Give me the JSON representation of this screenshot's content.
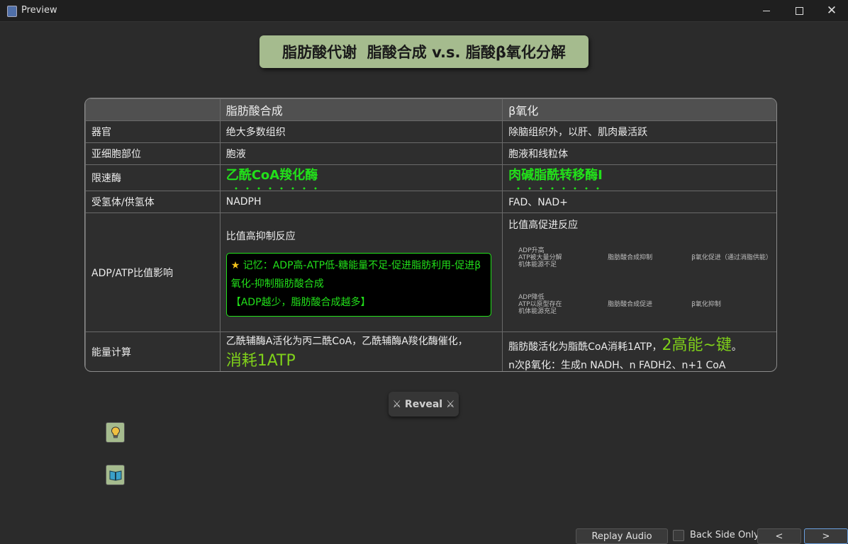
{
  "window": {
    "title": "Preview"
  },
  "card": {
    "title": "脂肪酸代谢  脂酸合成 v.s. 脂酸β氧化分解"
  },
  "table": {
    "headers": [
      "",
      "脂肪酸合成",
      "β氧化"
    ],
    "rows": {
      "organ": {
        "label": "器官",
        "synth": "绝大多数组织",
        "beta": "除脑组织外，以肝、肌肉最活跃"
      },
      "subcell": {
        "label": "亚细胞部位",
        "synth": "胞液",
        "beta": "胞液和线粒体"
      },
      "enzyme": {
        "label": "限速酶",
        "synth": "乙酰CoA羧化酶",
        "beta": "肉碱脂酰转移酶Ⅰ"
      },
      "acceptor": {
        "label": "受氢体/供氢体",
        "synth": "NADPH",
        "beta": "FAD、NAD+"
      },
      "adp": {
        "label": "ADP/ATP比值影响",
        "synth": "比值高抑制反应",
        "memory_line1": "记忆：ADP高-ATP低-糖能量不足-促进脂肪利用-促进β氧化-抑制脂肪酸合成",
        "memory_line2": "【ADP越少，脂肪酸合成越多】",
        "beta": "比值高促进反应",
        "mini_table": {
          "r1c1_l1": "ADP升高",
          "r1c1_l2": "ATP被大量分解",
          "r1c1_l3": "机体能源不足",
          "r1c2": "脂肪酸合成抑制",
          "r1c3": "β氧化促进（通过消脂供能）",
          "r2c1_l1": "ADP降低",
          "r2c1_l2": "ATP以原型存在",
          "r2c1_l3": "机体能源充足",
          "r2c2": "脂肪酸合成促进",
          "r2c3": "β氧化抑制"
        }
      },
      "energy": {
        "label": "能量计算",
        "synth_text": "乙酰辅酶A活化为丙二酰CoA，乙酰辅酶A羧化酶催化，",
        "synth_big": "消耗1ATP",
        "beta_text": "脂肪酸活化为脂酰CoA消耗1ATP，",
        "beta_big": "2高能~键",
        "beta_end": "。",
        "beta_line2": "n次β氧化：生成n NADH、n FADH2、n+1 CoA"
      }
    }
  },
  "buttons": {
    "reveal": "⚔ Reveal ⚔",
    "replay": "Replay Audio",
    "back_side_only": "Back Side Only",
    "prev": "<",
    ">": ">",
    "next": ">"
  },
  "colors": {
    "accent_green": "#22e01a",
    "title_bg": "#a5bb8e"
  }
}
